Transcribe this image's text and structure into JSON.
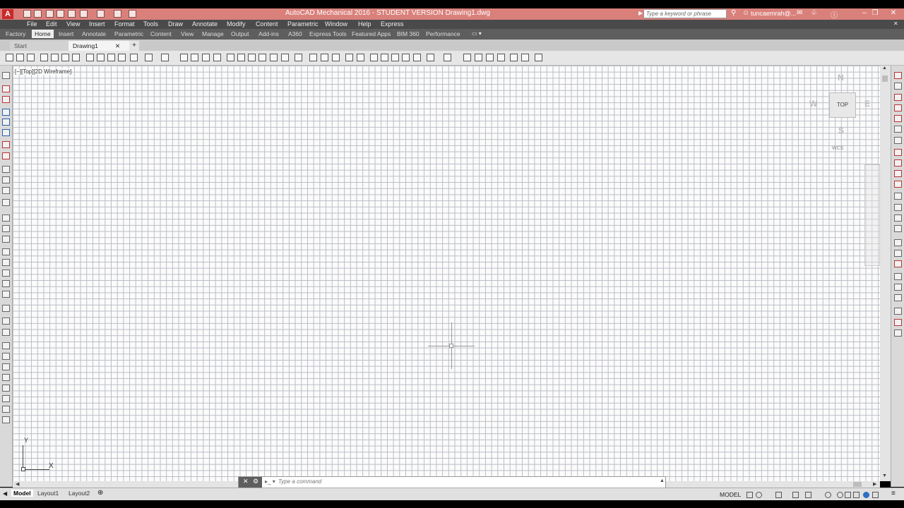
{
  "app": {
    "title": "AutoCAD Mechanical 2016 - STUDENT VERSION    Drawing1.dwg",
    "search_placeholder": "Type a keyword or phrase",
    "user": "tuncaemrah@..."
  },
  "menu": [
    "File",
    "Edit",
    "View",
    "Insert",
    "Format",
    "Tools",
    "Draw",
    "Annotate",
    "Modify",
    "Content",
    "Parametric",
    "Window",
    "Help",
    "Express"
  ],
  "ribbon_tabs": [
    "Factory",
    "Home",
    "Insert",
    "Annotate",
    "Parametric",
    "Content",
    "View",
    "Manage",
    "Output",
    "Add-ins",
    "A360",
    "Express Tools",
    "Featured Apps",
    "BIM 360",
    "Performance"
  ],
  "ribbon_active": "Home",
  "file_tabs": {
    "start": "Start",
    "drawing": "Drawing1"
  },
  "viewport": {
    "label": "[−][Top][2D Wireframe]"
  },
  "viewcube": {
    "face": "TOP",
    "north": "N",
    "south": "S",
    "east": "E",
    "west": "W",
    "wcs": "WCS"
  },
  "ucs": {
    "x": "X",
    "y": "Y"
  },
  "command": {
    "placeholder": "Type a command"
  },
  "layout_tabs": [
    "Model",
    "Layout1",
    "Layout2"
  ],
  "status": {
    "model": "MODEL"
  },
  "colors": {
    "titlebar": "#d9807b",
    "menubar": "#4a4a4a",
    "canvas": "#fbfbfb",
    "grid": "#b9bcc4"
  }
}
